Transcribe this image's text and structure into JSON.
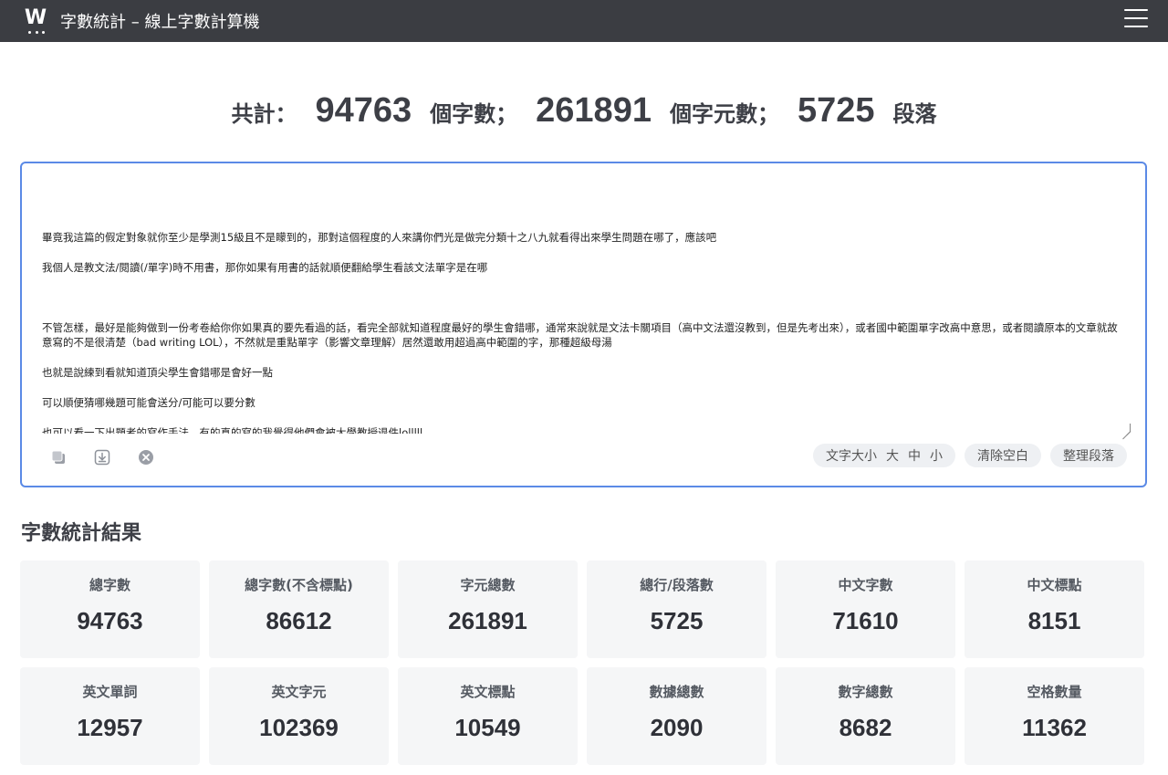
{
  "header": {
    "logo_letter": "W",
    "title": "字數統計 – 線上字數計算機",
    "menu_icon": "hamburger-menu-icon"
  },
  "summary": {
    "prefix": "共計：",
    "chars": "94763",
    "chars_label": "個字數；",
    "char_units": "261891",
    "char_units_label": "個字元數；",
    "paragraphs": "5725",
    "paragraphs_label": "段落"
  },
  "editor": {
    "lines": [
      "",
      "畢竟我這篇的假定對象就你至少是學測15級且不是矇到的，那對這個程度的人來講你們光是做完分類十之八九就看得出來學生問題在哪了，應該吧",
      "",
      "我個人是教文法/閱讀(/單字)時不用書，那你如果有用書的話就順便翻給學生看該文法單字是在哪",
      "",
      "",
      "",
      "不管怎樣，最好是能夠做到一份考卷給你你如果真的要先看過的話，看完全部就知道程度最好的學生會錯哪，通常來說就是文法卡關項目（高中文法還沒教到，但是先考出來），或者國中範圍單字改高中意思，或者閱讀原本的文章就故意寫的不是很清楚（bad writing LOL），不然就是重點單字（影響文章理解）居然還敢用超過高中範圍的字，那種超級母湯",
      "",
      "也就是說練到看就知道頂尖學生會錯哪是會好一點",
      "",
      "可以順便猜哪幾題可能會送分/可能可以要分數",
      "",
      "也可以看一下出題者的寫作手法，有的真的寫的我覺得他們會被大學教授退件lolllll"
    ],
    "tools": [
      "copy-icon",
      "download-icon",
      "clear-icon"
    ],
    "font_size_label": "文字大小",
    "font_large": "大",
    "font_medium": "中",
    "font_small": "小",
    "clear_space_label": "清除空白",
    "tidy_paragraph_label": "整理段落"
  },
  "results": {
    "title": "字數統計結果",
    "cards": [
      {
        "label": "總字數",
        "value": "94763"
      },
      {
        "label": "總字數(不含標點)",
        "value": "86612"
      },
      {
        "label": "字元總數",
        "value": "261891"
      },
      {
        "label": "總行/段落數",
        "value": "5725"
      },
      {
        "label": "中文字數",
        "value": "71610"
      },
      {
        "label": "中文標點",
        "value": "8151"
      },
      {
        "label": "英文單詞",
        "value": "12957"
      },
      {
        "label": "英文字元",
        "value": "102369"
      },
      {
        "label": "英文標點",
        "value": "10549"
      },
      {
        "label": "數據總數",
        "value": "2090"
      },
      {
        "label": "數字總數",
        "value": "8682"
      },
      {
        "label": "空格數量",
        "value": "11362"
      }
    ]
  },
  "colors": {
    "header_bg": "#3b3d42",
    "accent_border": "#5b8ae6",
    "card_bg": "#f5f6f7"
  }
}
